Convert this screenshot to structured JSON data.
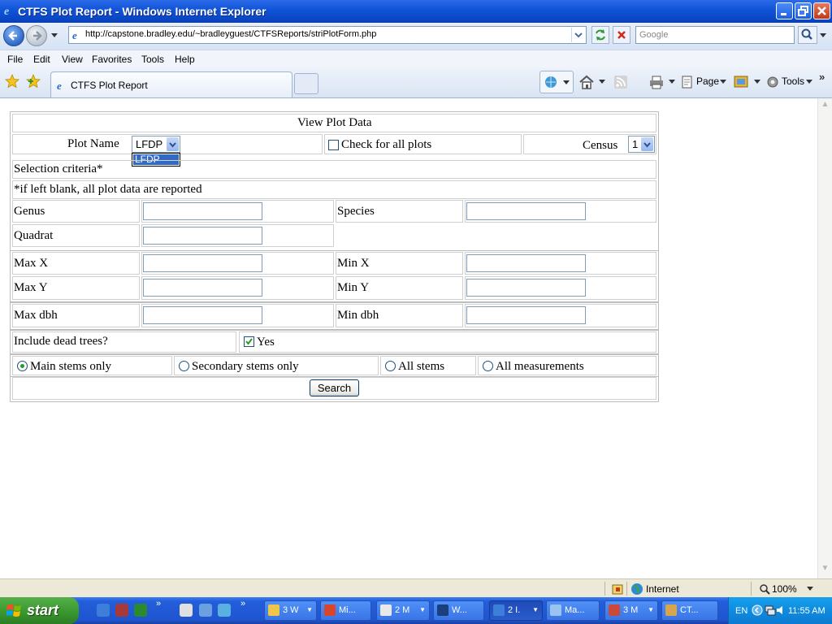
{
  "window": {
    "title": "CTFS Plot Report - Windows Internet Explorer"
  },
  "browser": {
    "url": "http://capstone.bradley.edu/~bradleyguest/CTFSReports/striPlotForm.php",
    "search_placeholder": "Google",
    "menu": [
      "File",
      "Edit",
      "View",
      "Favorites",
      "Tools",
      "Help"
    ],
    "tab_title": "CTFS Plot Report",
    "commands": {
      "page": "Page",
      "tools": "Tools"
    }
  },
  "form": {
    "heading": "View Plot Data",
    "plot_name_label": "Plot Name",
    "plot_name_value": "LFDP",
    "plot_name_dropdown_option": "LFDP",
    "all_plots_label": "Check for all plots",
    "census_label": "Census",
    "census_value": "1",
    "selection_criteria": "Selection criteria*",
    "blank_note": "*if left blank, all plot data are reported",
    "genus_label": "Genus",
    "species_label": "Species",
    "quadrat_label": "Quadrat",
    "max_x_label": "Max X",
    "min_x_label": "Min X",
    "max_y_label": "Max Y",
    "min_y_label": "Min Y",
    "max_dbh_label": "Max dbh",
    "min_dbh_label": "Min dbh",
    "dead_trees_label": "Include dead trees?",
    "dead_trees_yes": "Yes",
    "dead_trees_checked": true,
    "stem_options": [
      "Main stems only",
      "Secondary stems only",
      "All stems",
      "All measurements"
    ],
    "stem_selected": "Main stems only",
    "search_button": "Search"
  },
  "statusbar": {
    "zone": "Internet",
    "zoom": "100%"
  },
  "taskbar": {
    "start": "start",
    "buttons": [
      "3 W",
      "Mi...",
      "2 M",
      "W...",
      "2 I.",
      "Ma...",
      "3 M",
      "CT..."
    ],
    "language": "EN",
    "clock": "11:55 AM"
  },
  "colors": {
    "titlebar": "#0a46c6",
    "taskbar": "#245edb",
    "start": "#3c9a31"
  }
}
